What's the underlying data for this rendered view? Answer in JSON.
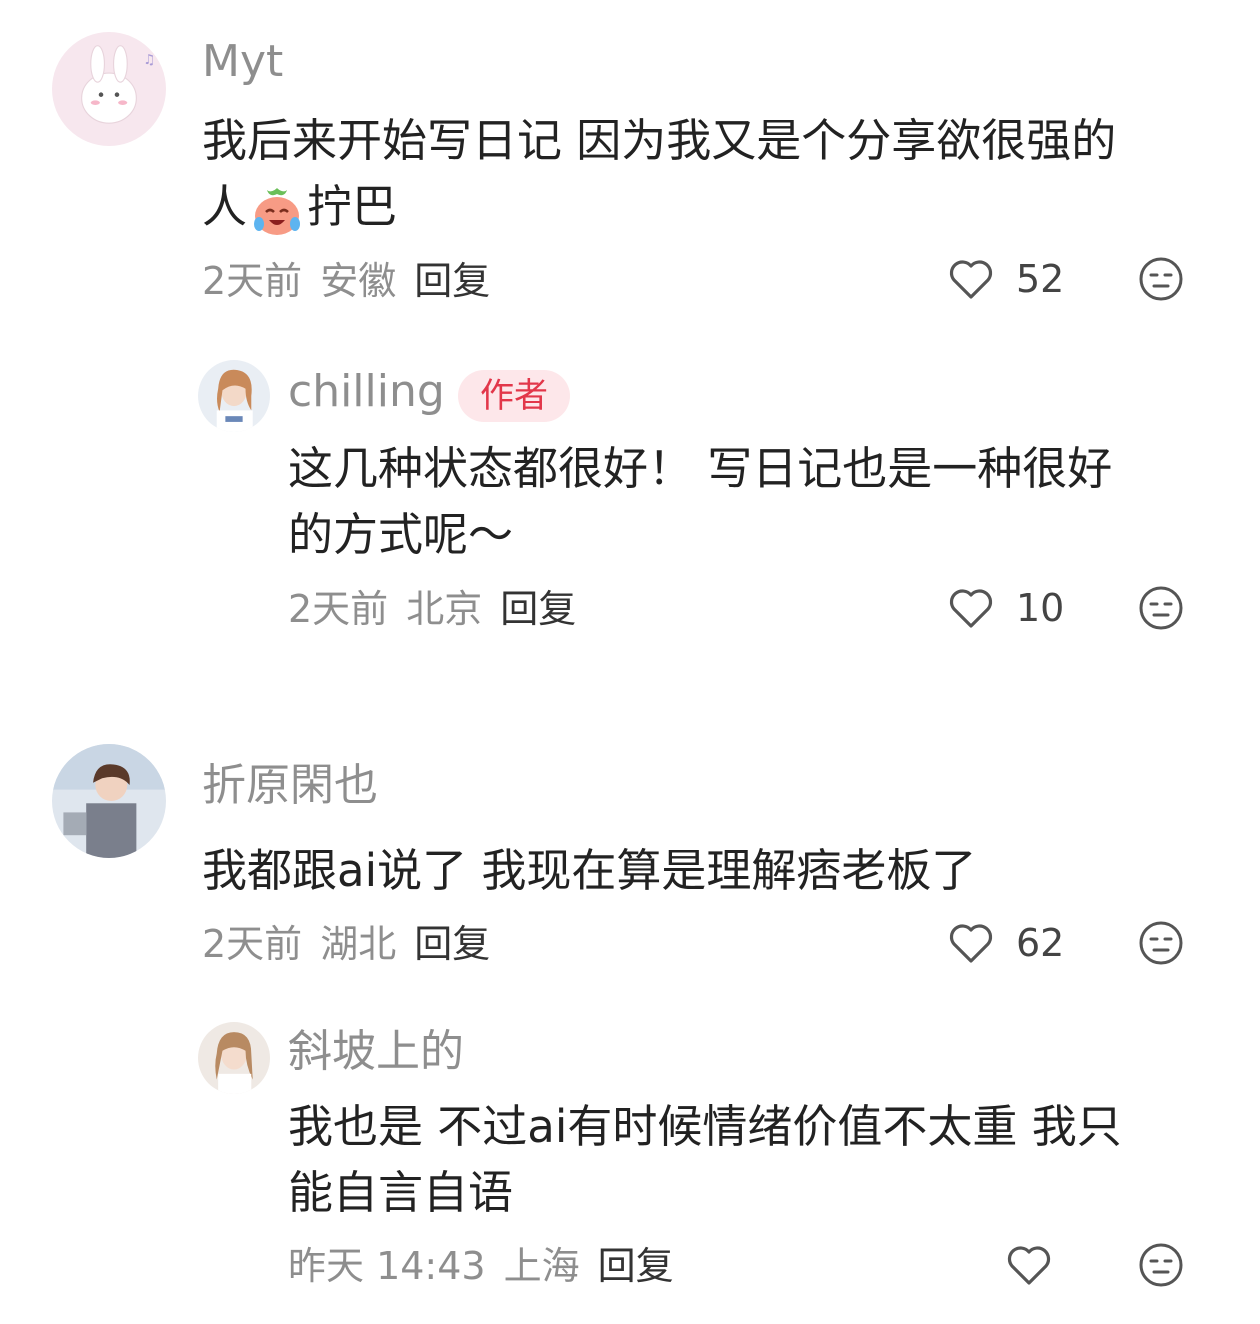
{
  "comments": [
    {
      "user": "Myt",
      "line1": "我后来开始写日记 因为我又是个分享欲很强的",
      "line2_pre": "人",
      "line2_emoji": "crying-laughing-peach-emoji",
      "line2_post": "拧巴",
      "time": "2天前",
      "location": "安徽",
      "reply": "回复",
      "likes": "52"
    },
    {
      "user": "chilling",
      "badge": "作者",
      "line1": "这几种状态都很好！ 写日记也是一种很好",
      "line2": "的方式呢～",
      "time": "2天前",
      "location": "北京",
      "reply": "回复",
      "likes": "10"
    },
    {
      "user": "折原閑也",
      "line1": "我都跟ai说了 我现在算是理解痞老板了",
      "time": "2天前",
      "location": "湖北",
      "reply": "回复",
      "likes": "62"
    },
    {
      "user": "斜坡上的",
      "line1": "我也是 不过ai有时候情绪价值不太重 我只",
      "line2": "能自言自语",
      "time": "昨天 14:43",
      "location": "上海",
      "reply": "回复",
      "likes": ""
    }
  ],
  "colors": {
    "author_badge": "#e2374a",
    "meta_text": "#8e8e8e"
  },
  "icons": [
    "heart-outline-icon",
    "unimpressed-face-icon"
  ]
}
